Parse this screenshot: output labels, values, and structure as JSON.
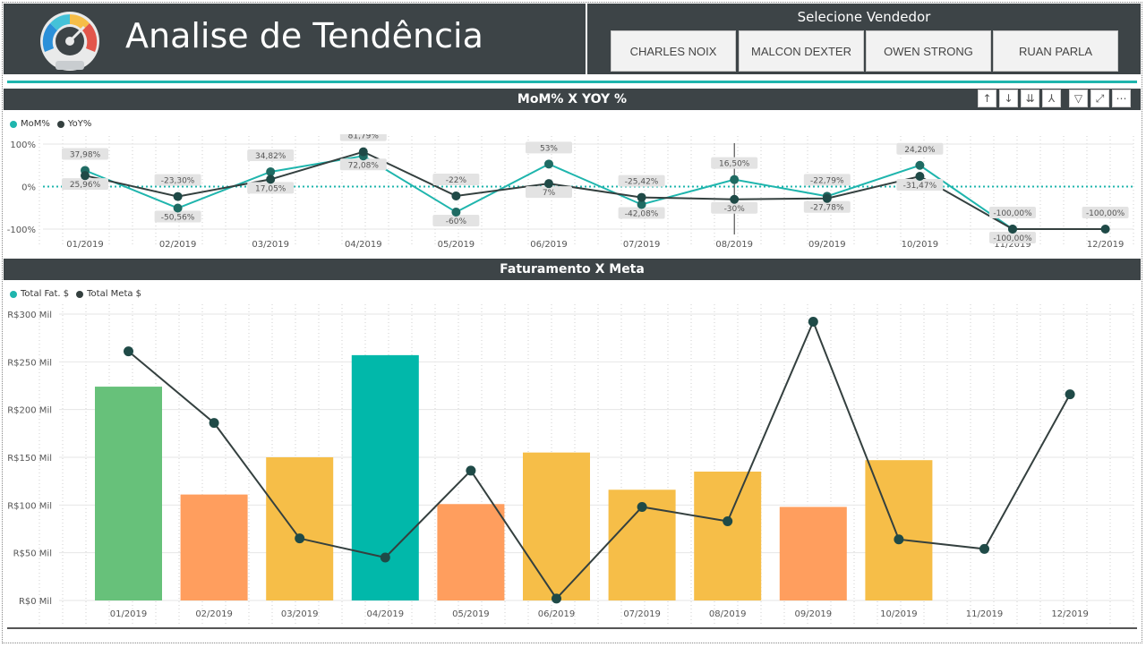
{
  "header": {
    "title": "Analise de Tendência",
    "vendor_title": "Selecione Vendedor",
    "vendors": [
      "CHARLES NOIX",
      "MALCON DEXTER",
      "OWEN STRONG",
      "RUAN PARLA"
    ]
  },
  "toolbar": {
    "icons": [
      "arrow-up-icon",
      "arrow-down-icon",
      "double-arrow-down-icon",
      "expand-hierarchy-icon",
      "filter-icon",
      "focus-mode-icon",
      "more-options-icon"
    ]
  },
  "colors": {
    "header_bg": "#3d4447",
    "accent": "#1fb5ad",
    "dark_series": "#34403f",
    "bar_green": "#67c17a",
    "bar_orange": "#ff9e5e",
    "bar_yellow": "#f6be48",
    "bar_teal": "#01b8aa"
  },
  "chart_data": [
    {
      "type": "line",
      "title": "MoM% X YOY %",
      "categories": [
        "01/2019",
        "02/2019",
        "03/2019",
        "04/2019",
        "05/2019",
        "06/2019",
        "07/2019",
        "08/2019",
        "09/2019",
        "10/2019",
        "11/2019",
        "12/2019"
      ],
      "yticks": [
        "100%",
        "0%",
        "-100%"
      ],
      "ylim": [
        -100,
        100
      ],
      "grid": true,
      "legend": "top-left",
      "series": [
        {
          "name": "MoM%",
          "color": "#1fb5ad",
          "values": [
            37.98,
            -50.56,
            34.82,
            72.08,
            -60.0,
            53.0,
            -42.08,
            16.5,
            -22.79,
            50.0,
            -100.0,
            null
          ],
          "labels": [
            "37,98%",
            "-50,56%",
            "34,82%",
            "72,08%",
            "-60%",
            "53%",
            "-42,08%",
            "16,50%",
            "-22,79%",
            "24,20%",
            "-100,00%",
            ""
          ]
        },
        {
          "name": "YoY%",
          "color": "#34403f",
          "values": [
            25.96,
            -23.3,
            17.05,
            81.79,
            -22.0,
            7.0,
            -25.42,
            -30.0,
            -27.78,
            24.2,
            -100.0,
            -100.0
          ],
          "labels": [
            "25,96%",
            "-23,30%",
            "17,05%",
            "81,79%",
            "-22%",
            "7%",
            "-25,42%",
            "-30%",
            "-27,78%",
            "-31,47%",
            "-100,00%",
            "-100,00%"
          ]
        }
      ]
    },
    {
      "type": "bar",
      "title": "Faturamento X Meta",
      "categories": [
        "01/2019",
        "02/2019",
        "03/2019",
        "04/2019",
        "05/2019",
        "06/2019",
        "07/2019",
        "08/2019",
        "09/2019",
        "10/2019",
        "11/2019",
        "12/2019"
      ],
      "yticks": [
        "R$0 Mil",
        "R$50 Mil",
        "R$100 Mil",
        "R$150 Mil",
        "R$200 Mil",
        "R$250 Mil",
        "R$300 Mil"
      ],
      "ylim": [
        0,
        300
      ],
      "grid": true,
      "legend": "top-left",
      "series": [
        {
          "name": "Total Fat. $",
          "type": "bar",
          "values": [
            224,
            111,
            150,
            257,
            101,
            155,
            116,
            135,
            98,
            147,
            null,
            null
          ],
          "colors": [
            "#67c17a",
            "#ff9e5e",
            "#f6be48",
            "#01b8aa",
            "#ff9e5e",
            "#f6be48",
            "#f6be48",
            "#f6be48",
            "#ff9e5e",
            "#f6be48",
            "",
            ""
          ]
        },
        {
          "name": "Total Meta $",
          "type": "line",
          "color": "#34403f",
          "values": [
            261,
            186,
            65,
            45,
            136,
            2,
            98,
            83,
            292,
            64,
            54,
            216
          ]
        }
      ]
    }
  ]
}
